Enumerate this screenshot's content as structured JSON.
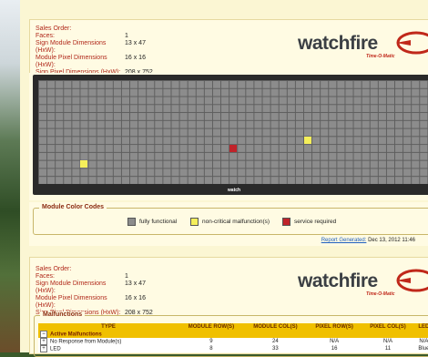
{
  "panel1": {
    "sales_order_label": "Sales Order:",
    "rows": [
      {
        "key": "Faces:",
        "value": "1"
      },
      {
        "key": "Sign Module Dimensions (HxW):",
        "value": "13 x 47"
      },
      {
        "key": "Module Pixel Dimensions (HxW):",
        "value": "16 x 16"
      },
      {
        "key": "Sign Pixel Dimensions (HxW):",
        "value": "208 x 752"
      }
    ]
  },
  "logo": {
    "name": "watchfire",
    "sub": "Time-O-Matic",
    "plate": "watch"
  },
  "sign": {
    "modules": [
      {
        "row": 9,
        "col": 24,
        "status": "service required"
      },
      {
        "row": 8,
        "col": 33,
        "status": "non-critical malfunction(s)"
      },
      {
        "row": 11,
        "col": 6,
        "status": "non-critical malfunction(s)"
      }
    ],
    "grid_rows": 13,
    "grid_cols": 47
  },
  "legend": {
    "title": "Module Color Codes",
    "items": [
      {
        "label": "fully functional",
        "color": "#8c8c8c"
      },
      {
        "label": "non-critical malfunction(s)",
        "color": "#f5ef5a"
      },
      {
        "label": "service required",
        "color": "#c0232a"
      }
    ]
  },
  "report": {
    "label": "Report Generated:",
    "value": "Dec 13, 2012 11:46"
  },
  "panel2": {
    "sales_order_label": "Sales Order:",
    "rows": [
      {
        "key": "Faces:",
        "value": "1"
      },
      {
        "key": "Sign Module Dimensions (HxW):",
        "value": "13 x 47"
      },
      {
        "key": "Module Pixel Dimensions (HxW):",
        "value": "16 x 16"
      },
      {
        "key": "Sign Pixel Dimensions (HxW):",
        "value": "208 x 752"
      }
    ]
  },
  "malfunctions": {
    "title": "Malfunctions",
    "columns": [
      "TYPE",
      "MODULE ROW(S)",
      "MODULE COL(S)",
      "PIXEL ROW(S)",
      "PIXEL COL(S)",
      "LED"
    ],
    "section": "Active Malfunctions",
    "rows": [
      {
        "type": "No Response from Module(s)",
        "cells": [
          "9",
          "24",
          "N/A",
          "N/A",
          "N/A"
        ]
      },
      {
        "type": "LED",
        "cells": [
          "8",
          "33",
          "16",
          "11",
          "Blue"
        ]
      }
    ]
  },
  "colors": {
    "brand_red": "#c0281a",
    "table_header": "#f0c000"
  }
}
